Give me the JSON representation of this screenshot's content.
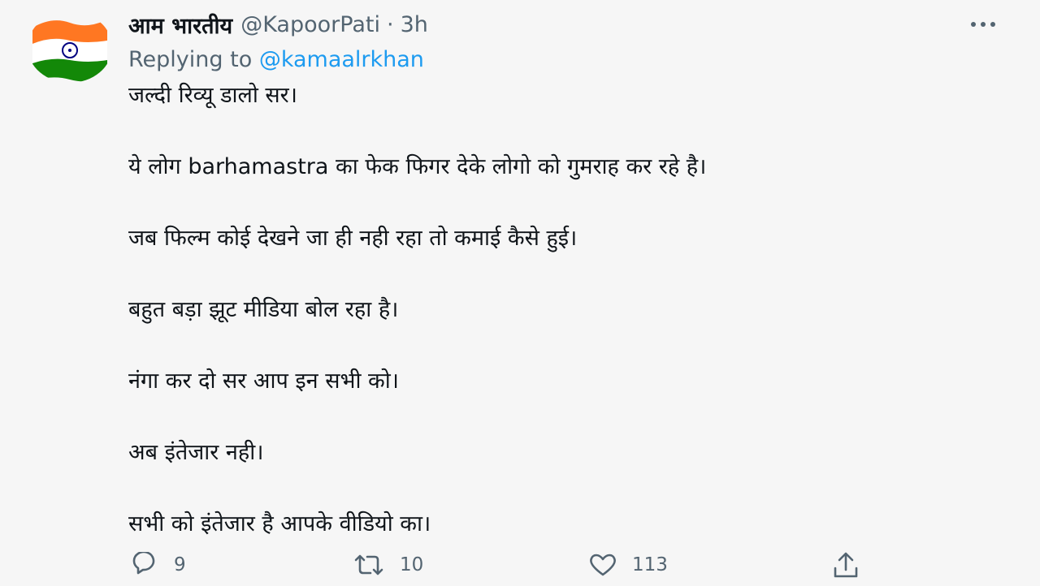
{
  "tweet": {
    "display_name": "आम भारतीय",
    "handle": "@KapoorPati",
    "separator": "·",
    "time": "3h",
    "replying_prefix": "Replying to",
    "replying_to": "@kamaalrkhan",
    "lines": [
      "जल्दी रिव्यू डालो सर।",
      "ये लोग barhamastra का फेक फिगर देके लोगो को गुमराह कर रहे है।",
      "जब फिल्म कोई देखने जा ही नही रहा तो कमाई कैसे हुई।",
      "बहुत बड़ा झूट मीडिया बोल रहा है।",
      "नंगा कर दो सर आप इन सभी को।",
      "अब इंतेजार नही।",
      "सभी को इंतेजार है आपके वीडियो का।"
    ],
    "replies": "9",
    "retweets": "10",
    "likes": "113"
  },
  "icons": {
    "avatar": "indian-flag-avatar",
    "more": "more-icon",
    "reply": "reply-icon",
    "retweet": "retweet-icon",
    "like": "like-icon",
    "share": "share-icon"
  },
  "colors": {
    "background": "#f6f6f6",
    "text": "#0f1419",
    "secondary": "#536471",
    "link": "#1d9bf0",
    "flag_saffron": "#ff7722",
    "flag_green": "#138808",
    "flag_chakra": "#000080"
  }
}
